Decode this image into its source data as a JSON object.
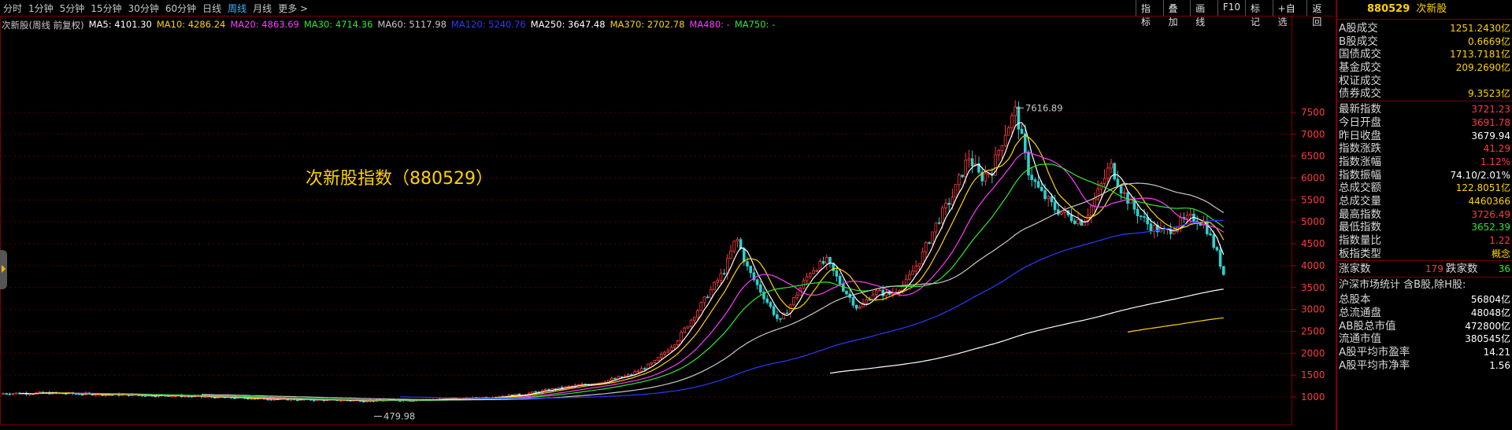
{
  "periods": [
    "分时",
    "1分钟",
    "5分钟",
    "15分钟",
    "30分钟",
    "60分钟",
    "日线",
    "周线",
    "月线",
    "更多 >"
  ],
  "active_period": "周线",
  "toolbar": [
    "指标",
    "叠加",
    "画线",
    "F10",
    "标记",
    "+自选",
    "返回"
  ],
  "ma_bar": {
    "name": "次新股(周线 前复权)",
    "items": [
      {
        "label": "MA5: 4101.30",
        "color": "#ffffff"
      },
      {
        "label": "MA10: 4286.24",
        "color": "#ffd200"
      },
      {
        "label": "MA20: 4863.69",
        "color": "#ff3bff"
      },
      {
        "label": "MA30: 4714.36",
        "color": "#30e830"
      },
      {
        "label": "MA60: 5117.98",
        "color": "#c8c8c8"
      },
      {
        "label": "MA120: 5240.76",
        "color": "#2a3aff"
      },
      {
        "label": "MA250: 3647.48",
        "color": "#ffffff"
      },
      {
        "label": "MA370: 2702.78",
        "color": "#ffd200"
      },
      {
        "label": "MA480: -",
        "color": "#ff3bff"
      },
      {
        "label": "MA750: -",
        "color": "#30e830"
      }
    ]
  },
  "chart_title": "次新股指数（880529）",
  "high_label": "7616.89",
  "low_label": "479.98",
  "y_ticks": [
    "7500",
    "7000",
    "6500",
    "6000",
    "5500",
    "5000",
    "4500",
    "4000",
    "3500",
    "3000",
    "2500",
    "2000",
    "1500",
    "1000"
  ],
  "colors": {
    "up": "#ff3b3b",
    "down": "#2ee52e",
    "accent": "#ffd200",
    "border": "#7a0000"
  },
  "side": {
    "code": "880529",
    "name": "次新股",
    "turnover": [
      {
        "label": "A股成交",
        "value": "1251.2430亿"
      },
      {
        "label": "B股成交",
        "value": "0.6669亿"
      },
      {
        "label": "国债成交",
        "value": "1713.7181亿"
      },
      {
        "label": "基金成交",
        "value": "209.2690亿"
      },
      {
        "label": "权证成交",
        "value": ""
      },
      {
        "label": "债券成交",
        "value": "9.3523亿"
      }
    ],
    "quote": [
      {
        "label": "最新指数",
        "value": "3721.23",
        "cls": "up"
      },
      {
        "label": "今日开盘",
        "value": "3691.78",
        "cls": "up"
      },
      {
        "label": "昨日收盘",
        "value": "3679.94",
        "cls": "wht"
      },
      {
        "label": "指数涨跌",
        "value": "41.29",
        "cls": "up"
      },
      {
        "label": "指数涨幅",
        "value": "1.12%",
        "cls": "up"
      },
      {
        "label": "指数振幅",
        "value": "74.10/2.01%",
        "cls": "wht"
      },
      {
        "label": "总成交额",
        "value": "122.8051亿",
        "cls": "yel"
      },
      {
        "label": "总成交量",
        "value": "4460366",
        "cls": "yel"
      },
      {
        "label": "最高指数",
        "value": "3726.49",
        "cls": "up"
      },
      {
        "label": "最低指数",
        "value": "3652.39",
        "cls": "down"
      },
      {
        "label": "指数量比",
        "value": "1.22",
        "cls": "up"
      },
      {
        "label": "板指类型",
        "value": "概念",
        "cls": "yel"
      }
    ],
    "updown": {
      "up_label": "涨家数",
      "up_value": "179",
      "down_label": "跌家数",
      "down_value": "36"
    },
    "market_title": "沪深市场统计 含B股,除H股:",
    "market": [
      {
        "label": "总股本",
        "value": "56804亿"
      },
      {
        "label": "总流通盘",
        "value": "48048亿"
      },
      {
        "label": "AB股总市值",
        "value": "472800亿"
      },
      {
        "label": "流通市值",
        "value": "380545亿"
      },
      {
        "label": "A股平均市盈率",
        "value": "14.21"
      },
      {
        "label": "A股平均市净率",
        "value": "1.56"
      }
    ]
  }
}
